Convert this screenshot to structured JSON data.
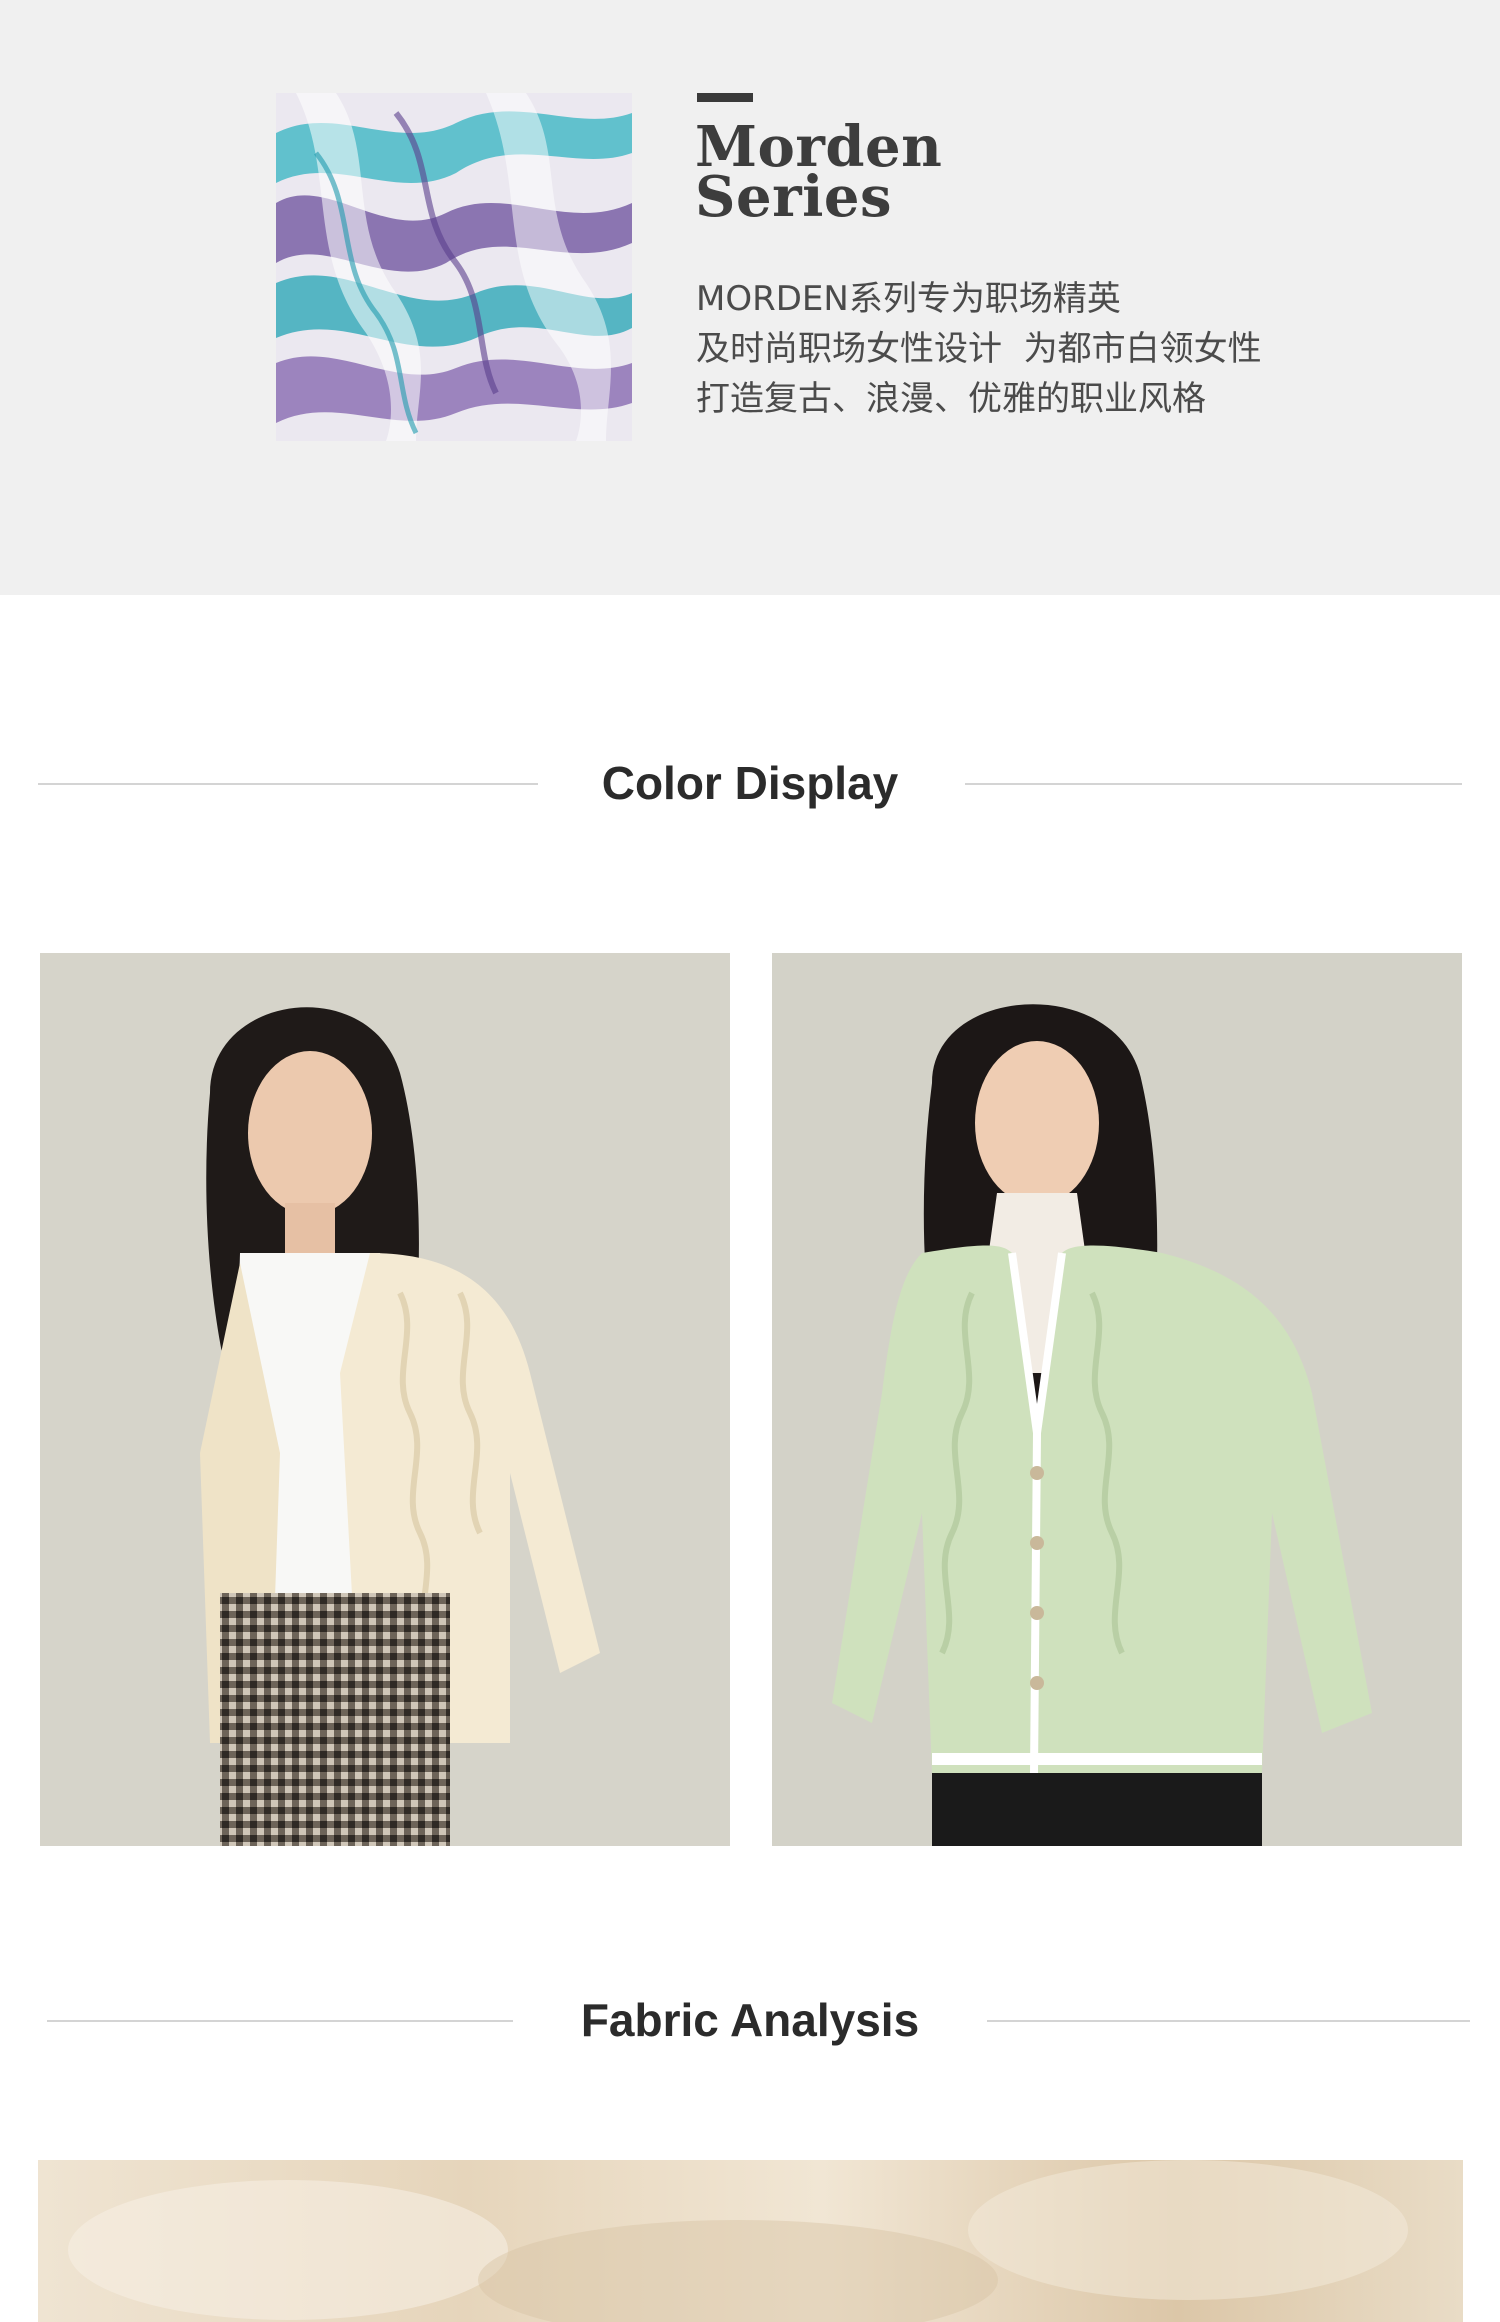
{
  "series": {
    "title_line1": "Morden",
    "title_line2": "Series",
    "description": [
      "MORDEN系列专为职场精英",
      "及时尚职场女性设计  为都市白领女性",
      "打造复古、浪漫、优雅的职业风格"
    ]
  },
  "color_display": {
    "heading": "Color Display",
    "photos": [
      {
        "colorway": "cream"
      },
      {
        "colorway": "mint green"
      }
    ]
  },
  "fabric_analysis": {
    "heading": "Fabric Analysis"
  },
  "colors": {
    "banner_bg": "#f0f0f0",
    "heading_text": "#2b2b2b",
    "rule": "#d4d4d4",
    "cream_cardigan": "#f4ead3",
    "mint_cardigan": "#cfe1bd"
  }
}
